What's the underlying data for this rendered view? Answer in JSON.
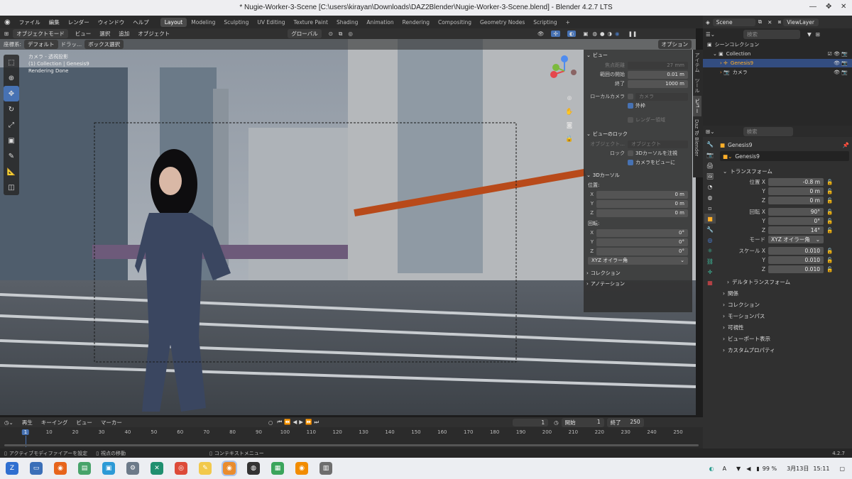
{
  "window": {
    "title": "* Nugie-Worker-3-Scene [C:\\users\\kirayan\\Downloads\\DAZ2Blender\\Nugie-Worker-3-Scene.blend] - Blender 4.2.7 LTS"
  },
  "menu": {
    "items": [
      "ファイル",
      "編集",
      "レンダー",
      "ウィンドウ",
      "ヘルプ"
    ]
  },
  "workspaces": {
    "tabs": [
      "Layout",
      "Modeling",
      "Sculpting",
      "UV Editing",
      "Texture Paint",
      "Shading",
      "Animation",
      "Rendering",
      "Compositing",
      "Geometry Nodes",
      "Scripting"
    ],
    "active": "Layout",
    "add": "+"
  },
  "scene": {
    "name": "Scene",
    "view_layer": "ViewLayer"
  },
  "viewport_header": {
    "mode": "オブジェクトモード",
    "menus": [
      "ビュー",
      "選択",
      "追加",
      "オブジェクト"
    ],
    "orientation": "グローバル"
  },
  "viewport_header2": {
    "coord_label": "座標系:",
    "coord": "デフォルト",
    "drag_label": "ドラッ...",
    "select": "ボックス選択",
    "options": "オプション"
  },
  "overlay_text": {
    "line1": "カメラ - 透視投影",
    "line2": "(1) Collection | Genesis9",
    "line3": "Rendering Done"
  },
  "npanel": {
    "view": {
      "header": "ビュー",
      "focal_label": "焦点距離",
      "focal": "27 mm",
      "clip_start_label": "範囲の開始",
      "clip_start": "0.01 m",
      "clip_end_label": "終了",
      "clip_end": "1000 m",
      "local_camera_label": "ローカルカメラ",
      "local_camera": "カメラ",
      "outer_frame": "外枠",
      "render_region": "レンダー領域"
    },
    "lock": {
      "header": "ビューのロック",
      "object_label": "オブジェクト...",
      "object": "オブジェクト",
      "lock_label": "ロック",
      "cursor": "3Dカーソルを注視",
      "camera_to_view": "カメラをビューに"
    },
    "cursor": {
      "header": "3Dカーソル",
      "location": "位置:",
      "x": "X",
      "y": "Y",
      "z": "Z",
      "lx": "0 m",
      "ly": "0 m",
      "lz": "0 m",
      "rotation": "回転:",
      "rx": "0°",
      "ry": "0°",
      "rz": "0°",
      "mode": "XYZ オイラー角"
    },
    "collection": "コレクション",
    "annotation": "アノテーション"
  },
  "vtabs": [
    "アイテム",
    "ツール",
    "ビュー",
    "Daz To Blender"
  ],
  "outliner": {
    "search": "検索",
    "root": "シーンコレクション",
    "collection": "Collection",
    "items": [
      "Genesis9",
      "カメラ"
    ]
  },
  "properties": {
    "search": "検索",
    "object_name": "Genesis9",
    "data_name": "Genesis9",
    "transform": {
      "header": "トランスフォーム",
      "location_x_label": "位置 X",
      "y": "Y",
      "z": "Z",
      "loc": [
        "-0.8 m",
        "0 m",
        "0 m"
      ],
      "rotation_x_label": "回転 X",
      "rot": [
        "90°",
        "0°",
        "14°"
      ],
      "mode_label": "モード",
      "mode": "XYZ オイラー角",
      "scale_x_label": "スケール X",
      "scale": [
        "0.010",
        "0.010",
        "0.010"
      ],
      "delta": "デルタトランスフォーム"
    },
    "sections": [
      "関係",
      "コレクション",
      "モーションパス",
      "可視性",
      "ビューポート表示",
      "カスタムプロパティ"
    ]
  },
  "timeline": {
    "menus": [
      "再生",
      "キーイング",
      "ビュー",
      "マーカー"
    ],
    "current": "1",
    "start_label": "開始",
    "start": "1",
    "end_label": "終了",
    "end": "250",
    "ticks": [
      "1",
      "10",
      "20",
      "30",
      "40",
      "50",
      "60",
      "70",
      "80",
      "90",
      "100",
      "110",
      "120",
      "130",
      "140",
      "150",
      "160",
      "170",
      "180",
      "190",
      "200",
      "210",
      "220",
      "230",
      "240",
      "250"
    ]
  },
  "status": {
    "left": "アクティブモディファイアーを設定",
    "mid": "視点の移動",
    "ctx": "コンテキストメニュー",
    "version": "4.2.7"
  },
  "taskbar": {
    "lang": "A",
    "battery": "99 %",
    "date": "3月13日",
    "time": "15:11"
  },
  "colors": {
    "accent": "#4772b3",
    "active_obj": "#ffaf29"
  }
}
